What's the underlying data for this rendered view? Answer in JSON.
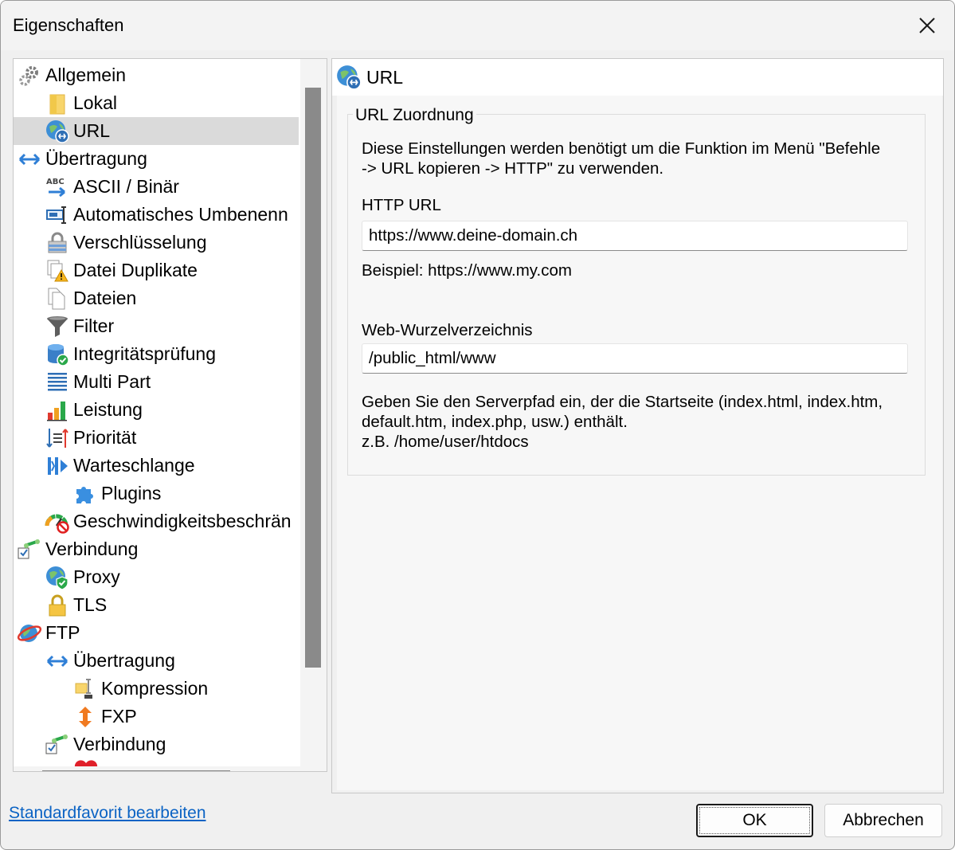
{
  "window": {
    "title": "Eigenschaften"
  },
  "tree": {
    "items": [
      {
        "label": "Allgemein",
        "icon": "gear-icon"
      },
      {
        "label": "Lokal",
        "icon": "folder-icon"
      },
      {
        "label": "URL",
        "icon": "globe-link-icon"
      },
      {
        "label": "Übertragung",
        "icon": "transfer-arrows-icon"
      },
      {
        "label": "ASCII / Binär",
        "icon": "ascii-binary-icon"
      },
      {
        "label": "Automatisches Umbenenn",
        "icon": "rename-icon"
      },
      {
        "label": "Verschlüsselung",
        "icon": "encryption-lock-icon"
      },
      {
        "label": "Datei Duplikate",
        "icon": "duplicate-warning-icon"
      },
      {
        "label": "Dateien",
        "icon": "files-icon"
      },
      {
        "label": "Filter",
        "icon": "filter-funnel-icon"
      },
      {
        "label": "Integritätsprüfung",
        "icon": "database-check-icon"
      },
      {
        "label": "Multi Part",
        "icon": "multipart-lines-icon"
      },
      {
        "label": "Leistung",
        "icon": "bar-chart-icon"
      },
      {
        "label": "Priorität",
        "icon": "priority-arrows-icon"
      },
      {
        "label": "Warteschlange",
        "icon": "queue-icon"
      },
      {
        "label": "Plugins",
        "icon": "puzzle-icon"
      },
      {
        "label": "Geschwindigkeitsbeschrän",
        "icon": "speed-limit-icon"
      },
      {
        "label": "Verbindung",
        "icon": "connection-check-icon"
      },
      {
        "label": "Proxy",
        "icon": "globe-shield-icon"
      },
      {
        "label": "TLS",
        "icon": "padlock-icon"
      },
      {
        "label": "FTP",
        "icon": "ftp-globe-icon"
      },
      {
        "label": "Übertragung",
        "icon": "transfer-arrows-icon"
      },
      {
        "label": "Kompression",
        "icon": "compression-icon"
      },
      {
        "label": "FXP",
        "icon": "fxp-arrows-icon"
      },
      {
        "label": "Verbindung",
        "icon": "connection-check-icon"
      }
    ]
  },
  "content": {
    "header_title": "URL",
    "group_title": "URL Zuordnung",
    "description_line1": "Diese Einstellungen werden benötigt um die Funktion im Menü \"Befehle",
    "description_line2": "-> URL kopieren -> HTTP\" zu verwenden.",
    "http_url_label": "HTTP URL",
    "http_url_value": "https://www.deine-domain.ch",
    "example_text": "Beispiel: https://www.my.com",
    "web_root_label": "Web-Wurzelverzeichnis",
    "web_root_value": "/public_html/www",
    "hint_line1": "Geben Sie den Serverpfad ein, der die Startseite (index.html, index.htm,",
    "hint_line2": "default.htm, index.php, usw.) enthält.",
    "hint_line3": "z.B. /home/user/htdocs"
  },
  "footer": {
    "link_label": "Standardfavorit bearbeiten",
    "ok_label": "OK",
    "cancel_label": "Abbrechen"
  }
}
